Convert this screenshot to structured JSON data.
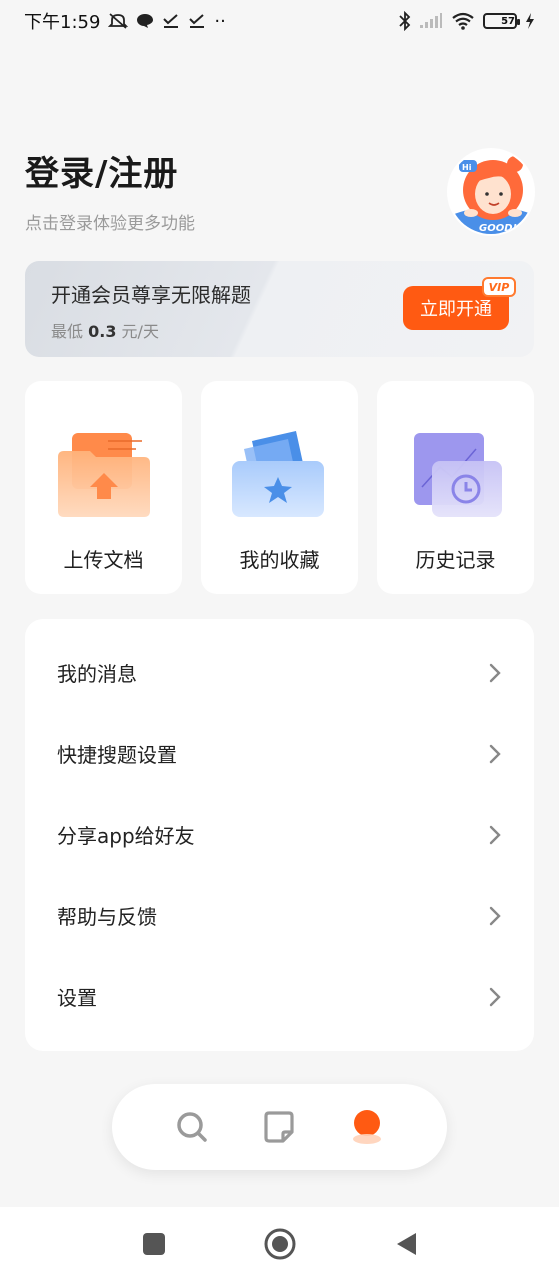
{
  "status_bar": {
    "time": "下午1:59",
    "extra": "··",
    "battery": "57"
  },
  "header": {
    "title": "登录/注册",
    "subtitle": "点击登录体验更多功能"
  },
  "vip": {
    "title": "开通会员尊享无限解题",
    "price_prefix": "最低",
    "price_value": "0.3",
    "price_unit": "元/天",
    "button_label": "立即开通",
    "badge": "VIP"
  },
  "cards": [
    {
      "label": "上传文档",
      "icon": "upload-folder-icon"
    },
    {
      "label": "我的收藏",
      "icon": "favorites-star-icon"
    },
    {
      "label": "历史记录",
      "icon": "history-clock-icon"
    }
  ],
  "menu": [
    {
      "label": "我的消息"
    },
    {
      "label": "快捷搜题设置"
    },
    {
      "label": "分享app给好友"
    },
    {
      "label": "帮助与反馈"
    },
    {
      "label": "设置"
    }
  ],
  "tabbar": {
    "tabs": [
      "search-icon",
      "notebook-icon",
      "profile-icon"
    ],
    "active_color": "#ff5a12"
  },
  "accent_color": "#ff5a12"
}
